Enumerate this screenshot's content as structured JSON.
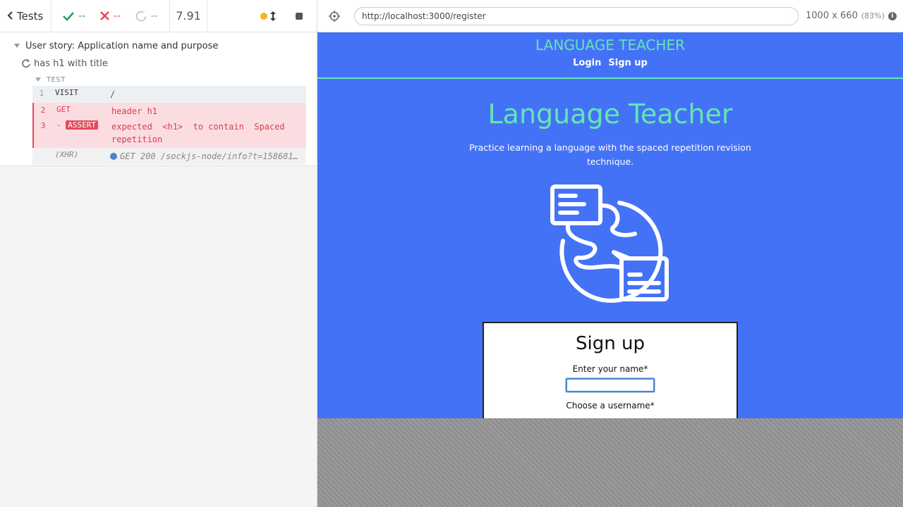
{
  "reporter": {
    "tests_label": "Tests",
    "passed": "--",
    "failed": "--",
    "pending": "--",
    "duration": "7.91",
    "suite_title": "User story: Application name and purpose",
    "test_title": "has h1 with title",
    "hook_label": "TEST",
    "commands": [
      {
        "num": "1",
        "name": "visit",
        "msg": "/"
      },
      {
        "num": "2",
        "name": "get",
        "msg": "header h1"
      },
      {
        "num": "3",
        "prefix": "-",
        "badge": "ASSERT",
        "msg": "expected  <h1>  to contain  Spaced repetition"
      },
      {
        "num": "",
        "name": "(XHR)",
        "msg": "GET 200 /sockjs-node/info?t=158681…"
      }
    ]
  },
  "aut_header": {
    "url": "http://localhost:3000/register",
    "viewport": "1000 x 660",
    "scale": "(83%)",
    "info_icon": "i"
  },
  "app": {
    "brand": "LANGUAGE TEACHER",
    "nav": [
      "Login",
      "Sign up"
    ],
    "hero_title": "Language Teacher",
    "tagline": "Practice learning a language with the spaced repetition revision technique.",
    "signup": {
      "title": "Sign up",
      "name_label": "Enter your name*",
      "name_value": "",
      "username_label": "Choose a username*"
    }
  },
  "colors": {
    "app_bg": "#4472f7",
    "accent": "#63e6b3",
    "error": "#e44a5a",
    "pass": "#2a9d5c"
  }
}
